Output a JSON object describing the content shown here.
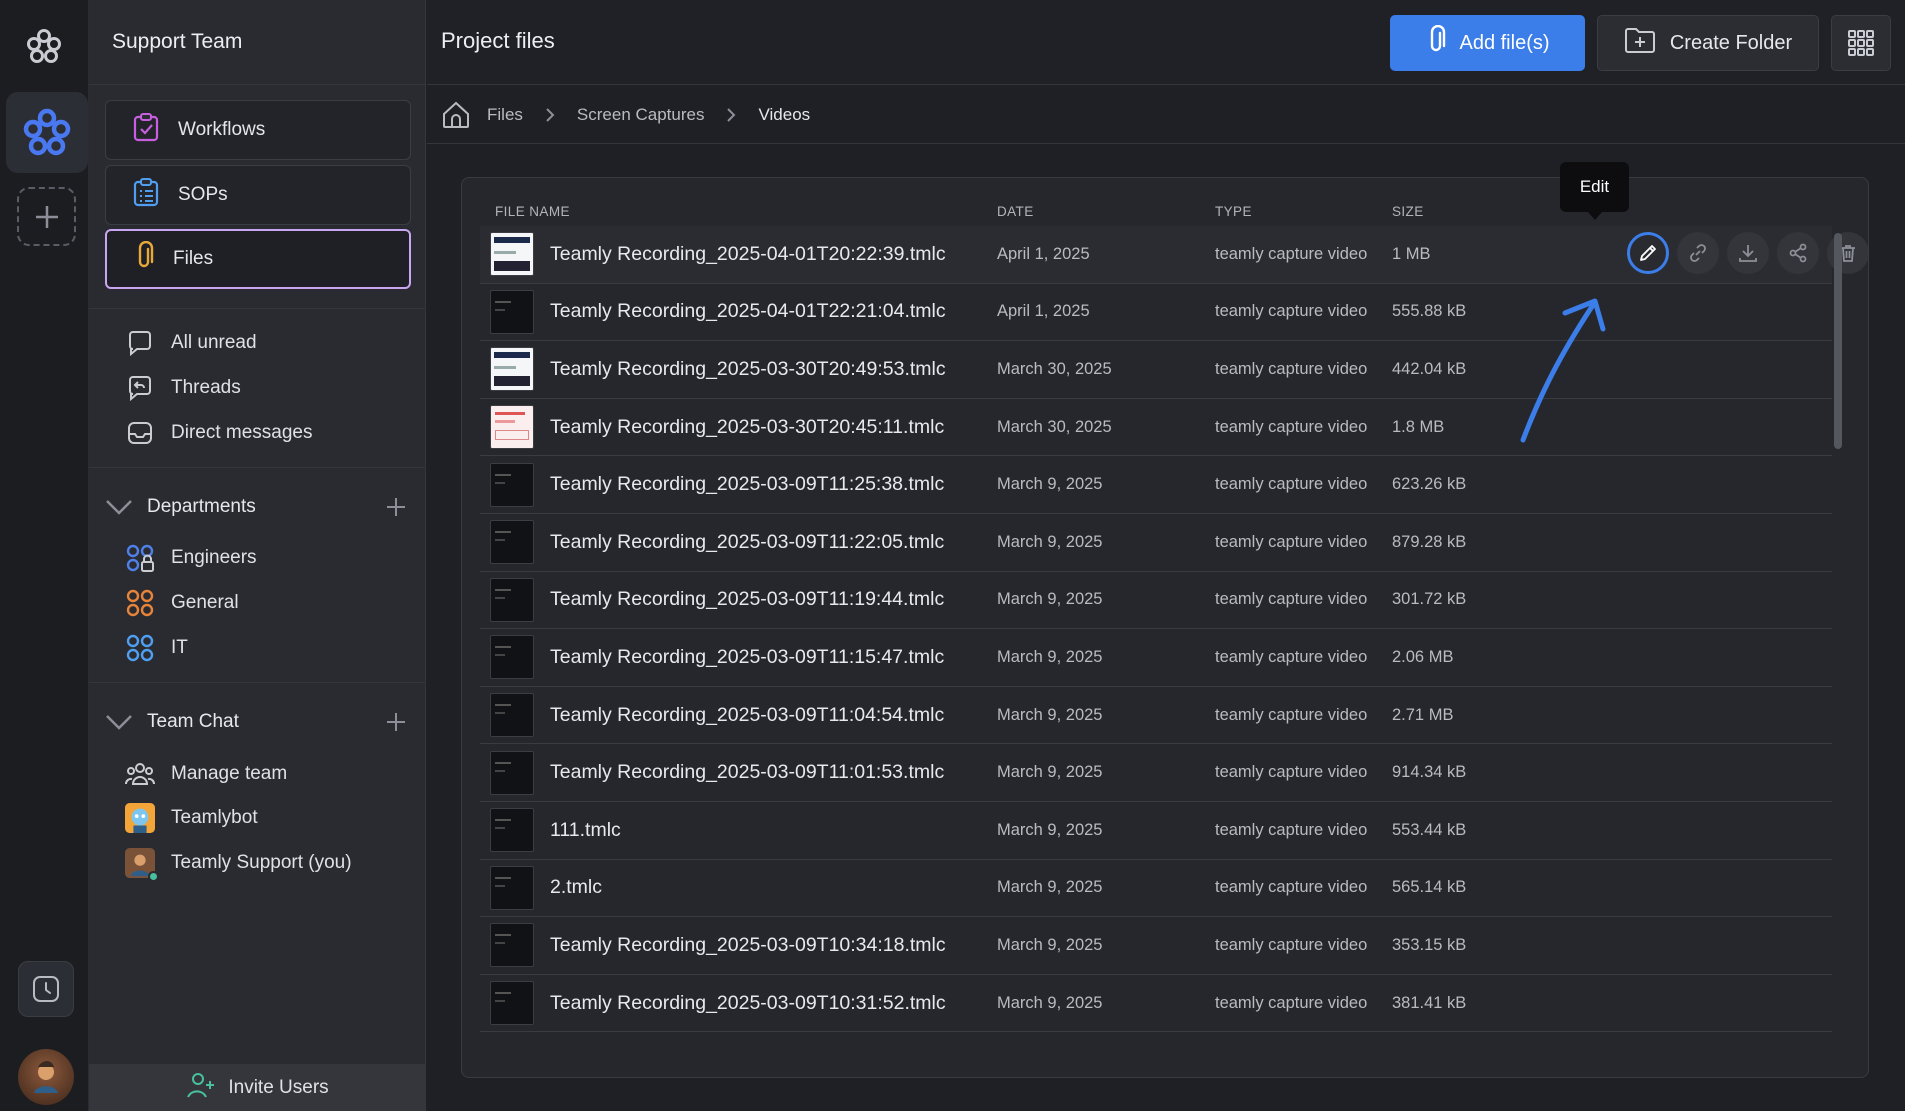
{
  "rail": {
    "logo_icon": "teamly-flower-icon",
    "team_icon": "teamly-team-icon",
    "add_team_icon": "plus-icon",
    "clock_icon": "clock-icon",
    "avatar_icon": "user-avatar"
  },
  "sidebar": {
    "team_name": "Support Team",
    "nav": [
      {
        "label": "Workflows",
        "icon": "clipboard-check-icon"
      },
      {
        "label": "SOPs",
        "icon": "list-doc-icon"
      },
      {
        "label": "Files",
        "icon": "paperclip-icon"
      }
    ],
    "links": [
      {
        "label": "All unread",
        "icon": "chat-bubble-icon"
      },
      {
        "label": "Threads",
        "icon": "threads-icon"
      },
      {
        "label": "Direct messages",
        "icon": "inbox-icon"
      }
    ],
    "departments": {
      "title": "Departments",
      "items": [
        {
          "label": "Engineers",
          "color": "#4f7fe8"
        },
        {
          "label": "General",
          "color": "#e8843a"
        },
        {
          "label": "IT",
          "color": "#4f9ef0"
        }
      ]
    },
    "team_chat": {
      "title": "Team Chat",
      "items": [
        {
          "label": "Manage team"
        },
        {
          "label": "Teamlybot"
        },
        {
          "label": "Teamly Support (you)"
        }
      ]
    },
    "invite_label": "Invite Users"
  },
  "header": {
    "title": "Project files",
    "add_label": "Add file(s)",
    "create_folder_label": "Create Folder"
  },
  "breadcrumb": [
    "Files",
    "Screen Captures",
    "Videos"
  ],
  "table": {
    "headers": {
      "name": "FILE NAME",
      "date": "DATE",
      "type": "TYPE",
      "size": "SIZE"
    },
    "rows": [
      {
        "name": "Teamly Recording_2025-04-01T20:22:39.tmlc",
        "date": "April 1, 2025",
        "type": "teamly capture video",
        "size": "1 MB",
        "thumb": "white"
      },
      {
        "name": "Teamly Recording_2025-04-01T22:21:04.tmlc",
        "date": "April 1, 2025",
        "type": "teamly capture video",
        "size": "555.88 kB",
        "thumb": "dark"
      },
      {
        "name": "Teamly Recording_2025-03-30T20:49:53.tmlc",
        "date": "March 30, 2025",
        "type": "teamly capture video",
        "size": "442.04 kB",
        "thumb": "white"
      },
      {
        "name": "Teamly Recording_2025-03-30T20:45:11.tmlc",
        "date": "March 30, 2025",
        "type": "teamly capture video",
        "size": "1.8 MB",
        "thumb": "pink"
      },
      {
        "name": "Teamly Recording_2025-03-09T11:25:38.tmlc",
        "date": "March 9, 2025",
        "type": "teamly capture video",
        "size": "623.26 kB",
        "thumb": "dark"
      },
      {
        "name": "Teamly Recording_2025-03-09T11:22:05.tmlc",
        "date": "March 9, 2025",
        "type": "teamly capture video",
        "size": "879.28 kB",
        "thumb": "dark"
      },
      {
        "name": "Teamly Recording_2025-03-09T11:19:44.tmlc",
        "date": "March 9, 2025",
        "type": "teamly capture video",
        "size": "301.72 kB",
        "thumb": "dark"
      },
      {
        "name": "Teamly Recording_2025-03-09T11:15:47.tmlc",
        "date": "March 9, 2025",
        "type": "teamly capture video",
        "size": "2.06 MB",
        "thumb": "dark"
      },
      {
        "name": "Teamly Recording_2025-03-09T11:04:54.tmlc",
        "date": "March 9, 2025",
        "type": "teamly capture video",
        "size": "2.71 MB",
        "thumb": "dark"
      },
      {
        "name": "Teamly Recording_2025-03-09T11:01:53.tmlc",
        "date": "March 9, 2025",
        "type": "teamly capture video",
        "size": "914.34 kB",
        "thumb": "dark"
      },
      {
        "name": "111.tmlc",
        "date": "March 9, 2025",
        "type": "teamly capture video",
        "size": "553.44 kB",
        "thumb": "dark"
      },
      {
        "name": "2.tmlc",
        "date": "March 9, 2025",
        "type": "teamly capture video",
        "size": "565.14 kB",
        "thumb": "dark"
      },
      {
        "name": "Teamly Recording_2025-03-09T10:34:18.tmlc",
        "date": "March 9, 2025",
        "type": "teamly capture video",
        "size": "353.15 kB",
        "thumb": "dark"
      },
      {
        "name": "Teamly Recording_2025-03-09T10:31:52.tmlc",
        "date": "March 9, 2025",
        "type": "teamly capture video",
        "size": "381.41 kB",
        "thumb": "dark"
      }
    ],
    "row_actions": [
      "pencil-icon",
      "link-icon",
      "download-icon",
      "share-icon",
      "trash-icon"
    ]
  },
  "tooltip": {
    "label": "Edit"
  },
  "colors": {
    "accent": "#3b7de9",
    "files_border": "#c9a5f2"
  }
}
